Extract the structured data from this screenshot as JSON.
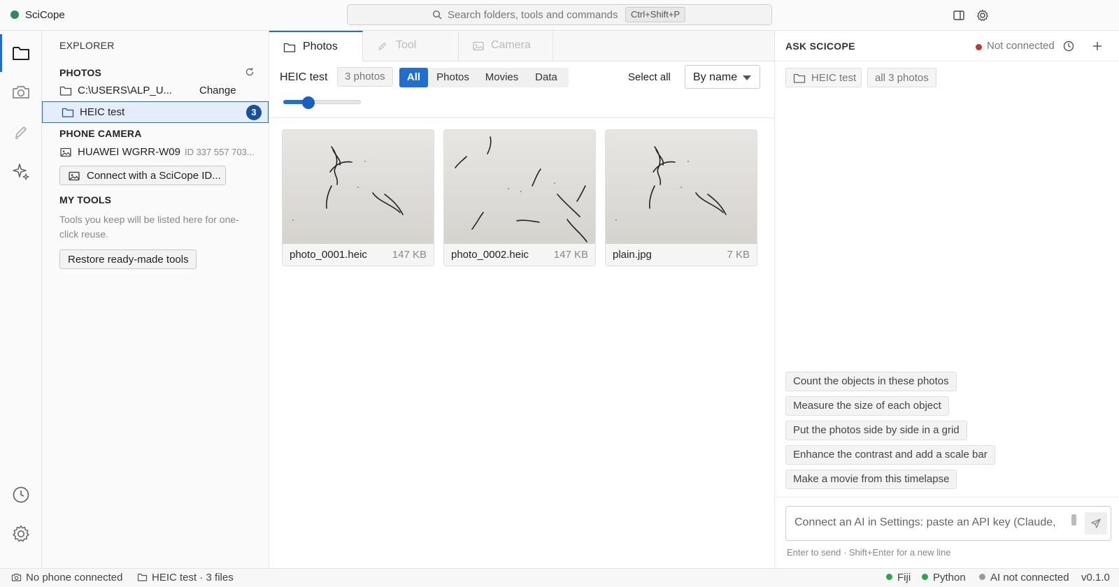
{
  "app": {
    "name": "SciCope"
  },
  "command_search": {
    "placeholder": "Search folders, tools and commands",
    "shortcut": "Ctrl+Shift+P"
  },
  "explorer": {
    "title": "EXPLORER",
    "photos_section": "PHOTOS",
    "folder_path": "C:\\USERS\\ALP_U...",
    "change_label": "Change",
    "selected_folder": {
      "name": "HEIC test",
      "count": "3"
    },
    "phone_camera_section": "PHONE CAMERA",
    "device": {
      "name": "HUAWEI WGRR-W09",
      "id": "ID 337 557 703..."
    },
    "connect_button": "Connect with a SciCope ID...",
    "my_tools_section": "MY TOOLS",
    "tools_hint": "Tools you keep will be listed here for one-click reuse.",
    "restore_button": "Restore ready-made tools"
  },
  "tabs": [
    {
      "label": "Photos",
      "icon": "folder-icon",
      "active": true
    },
    {
      "label": "Tool",
      "icon": "pencil-icon",
      "active": false
    },
    {
      "label": "Camera",
      "icon": "image-icon",
      "active": false
    }
  ],
  "photos": {
    "folder_title": "HEIC test",
    "count_chip": "3 photos",
    "filters": [
      "All",
      "Photos",
      "Movies",
      "Data"
    ],
    "active_filter": "All",
    "select_all": "Select all",
    "sort": "By name",
    "thumbnail_size_fraction": 0.32,
    "files": [
      {
        "name": "photo_0001.heic",
        "size": "147 KB"
      },
      {
        "name": "photo_0002.heic",
        "size": "147 KB"
      },
      {
        "name": "plain.jpg",
        "size": "7 KB"
      }
    ]
  },
  "ai": {
    "title": "ASK SCICOPE",
    "status": "Not connected",
    "status_color": "#c0392b",
    "context_chips": [
      "HEIC test",
      "all 3 photos"
    ],
    "suggestions": [
      "Count the objects in these photos",
      "Measure the size of each object",
      "Put the photos side by side in a grid",
      "Enhance the contrast and add a scale bar",
      "Make a movie from this timelapse"
    ],
    "input_placeholder": "Connect an AI in Settings: paste an API key (Claude,",
    "footer_hint": "Enter to send · Shift+Enter for a new line"
  },
  "statusbar": {
    "phone": "No phone connected",
    "folder": "HEIC test · 3 files",
    "fiji": "Fiji",
    "python": "Python",
    "ai": "AI not connected",
    "version": "v0.1.0"
  },
  "colors": {
    "accent": "#1f6fd1",
    "ok": "#27a844",
    "error": "#c0392b",
    "muted": "#999999"
  }
}
